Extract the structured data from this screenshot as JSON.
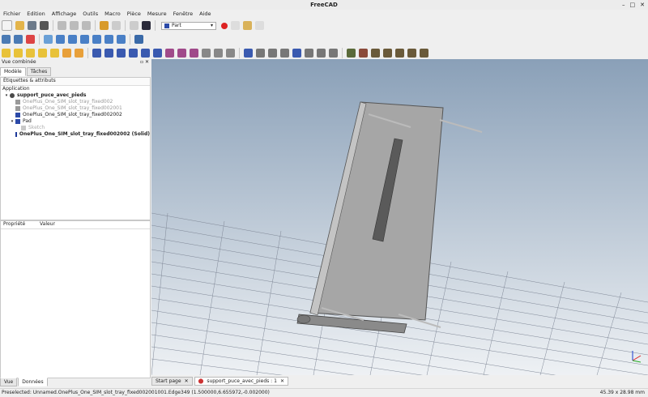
{
  "window": {
    "title": "FreeCAD",
    "controls": [
      "–",
      "□",
      "✕"
    ]
  },
  "menu": [
    "Fichier",
    "Edition",
    "Affichage",
    "Outils",
    "Macro",
    "Pièce",
    "Mesure",
    "Fenêtre",
    "Aide"
  ],
  "toolbar": {
    "workbench": "Part"
  },
  "left_panel": {
    "title": "Vue combinée",
    "tabs": [
      "Modèle",
      "Tâches"
    ],
    "tree_header": "Étiquettes & attributs",
    "application_label": "Application",
    "tree_items": [
      {
        "label": "support_puce_avec_pieds",
        "color": "#3a3a3a",
        "bold": true,
        "dim": false,
        "twisty": "▾"
      },
      {
        "label": "OnePlus_One_SIM_slot_tray_fixed002",
        "color": "#9a9a9a",
        "bold": false,
        "dim": true,
        "twisty": ""
      },
      {
        "label": "OnePlus_One_SIM_slot_tray_fixed002001",
        "color": "#9a9a9a",
        "bold": false,
        "dim": true,
        "twisty": ""
      },
      {
        "label": "OnePlus_One_SIM_slot_tray_fixed002002",
        "color": "#2c4aa8",
        "bold": false,
        "dim": false,
        "twisty": ""
      },
      {
        "label": "Pad",
        "color": "#2c4aa8",
        "bold": false,
        "dim": false,
        "twisty": "▾"
      },
      {
        "label": "Sketch",
        "color": "#b0b0b0",
        "bold": false,
        "dim": true,
        "twisty": ""
      },
      {
        "label": "OnePlus_One_SIM_slot_tray_fixed002002 (Solid)",
        "color": "#1e3a9a",
        "bold": true,
        "dim": false,
        "twisty": ""
      }
    ],
    "props_headers": [
      "Propriété",
      "Valeur"
    ],
    "bottom_tabs": [
      "Vue",
      "Données"
    ]
  },
  "doc_tabs": [
    {
      "label": "Start page",
      "active": false
    },
    {
      "label": "support_puce_avec_pieds : 1",
      "active": true
    }
  ],
  "status": {
    "left": "Preselected: Unnamed.OnePlus_One_SIM_slot_tray_fixed002001001.Edge349 (1.500000,6.655972,-0.002000)",
    "right": "45.39 x 28.98 mm"
  }
}
